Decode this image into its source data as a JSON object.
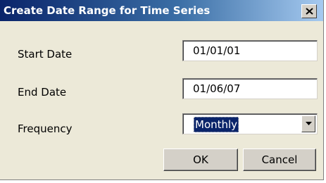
{
  "window": {
    "title": "Create Date Range for Time Series",
    "close_icon": "close-icon"
  },
  "form": {
    "start_date": {
      "label": "Start Date",
      "value": "01/01/01"
    },
    "end_date": {
      "label": "End Date",
      "value": "01/06/07"
    },
    "frequency": {
      "label": "Frequency",
      "selected": "Monthly"
    }
  },
  "buttons": {
    "ok": "OK",
    "cancel": "Cancel"
  },
  "colors": {
    "titlebar_start": "#0a246a",
    "titlebar_end": "#a6caf0",
    "dialog_bg": "#ece9d8",
    "selection": "#0a246a"
  }
}
